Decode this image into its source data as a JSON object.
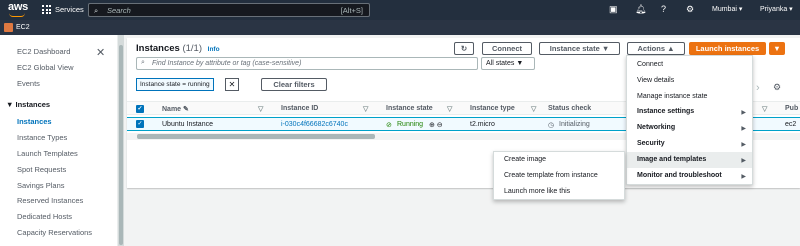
{
  "topbar": {
    "logo": "aws",
    "services_label": "Services",
    "search_placeholder": "Search",
    "search_shortcut": "[Alt+S]",
    "region": "Mumbai ▾",
    "user": "Priyanka ▾"
  },
  "subbar": {
    "service_name": "EC2"
  },
  "sidebar": {
    "close_glyph": "✕",
    "top_items": [
      "EC2 Dashboard",
      "EC2 Global View",
      "Events"
    ],
    "section_title": "▼ Instances",
    "instance_items": [
      "Instances",
      "Instance Types",
      "Launch Templates",
      "Spot Requests",
      "Savings Plans",
      "Reserved Instances",
      "Dedicated Hosts",
      "Capacity Reservations"
    ]
  },
  "panel": {
    "title": "Instances",
    "count": "(1/1)",
    "info": "Info",
    "refresh_glyph": "↻",
    "connect_label": "Connect",
    "instance_state_label": "Instance state ▼",
    "actions_label": "Actions ▲",
    "launch_label": "Launch instances",
    "launch_caret": "▼",
    "filter_placeholder": "Find Instance by attribute or tag (case-sensitive)",
    "states_label": "All states ▼",
    "token_label": "Instance state = running",
    "token_remove": "✕",
    "clear_filters": "Clear filters",
    "columns": [
      "Name ✎",
      "Instance ID",
      "Instance state",
      "Instance type",
      "Status check"
    ],
    "sort_glyph": "▽",
    "row": {
      "check": "✓",
      "name": "Ubuntu Instance",
      "instance_id": "i-030c4f66682c6740c",
      "state": "Running",
      "zoom": "⊕ ⊖",
      "type": "t2.micro",
      "status": "Initializing"
    },
    "extra_col_sort": "▽",
    "extra_col": "Pub",
    "extra_cell": "ec2",
    "pager_glyph": "›",
    "settings_glyph": "⚙"
  },
  "actions_menu": {
    "items": [
      {
        "label": "Connect",
        "bold": false,
        "sub": false
      },
      {
        "label": "View details",
        "bold": false,
        "sub": false
      },
      {
        "label": "Manage instance state",
        "bold": false,
        "sub": false
      },
      {
        "label": "Instance settings",
        "bold": true,
        "sub": true
      },
      {
        "label": "Networking",
        "bold": true,
        "sub": true
      },
      {
        "label": "Security",
        "bold": true,
        "sub": true
      },
      {
        "label": "Image and templates",
        "bold": true,
        "sub": true
      },
      {
        "label": "Monitor and troubleshoot",
        "bold": true,
        "sub": true
      }
    ],
    "submenu_arrow": "▶"
  },
  "image_submenu": {
    "items": [
      "Create image",
      "Create template from instance",
      "Launch more like this"
    ]
  },
  "colors": {
    "accent": "#0073bb",
    "orange": "#ec7211",
    "topbar": "#232f3e",
    "running": "#1d8102"
  }
}
